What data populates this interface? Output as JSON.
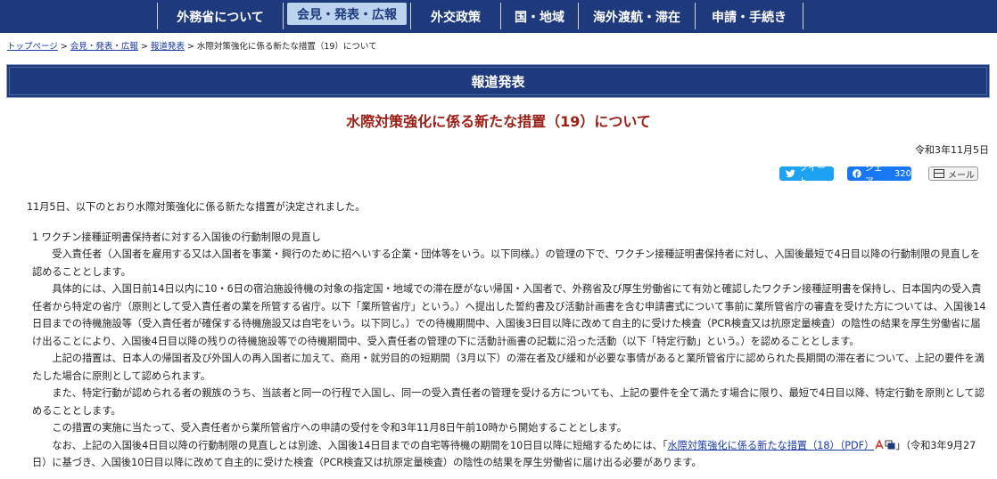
{
  "nav": {
    "items": [
      "外務省について",
      "会見・発表・広報",
      "外交政策",
      "国・地域",
      "海外渡航・滞在",
      "申請・手続き"
    ],
    "active_index": 1
  },
  "breadcrumb": {
    "home": "トップページ",
    "level1": "会見・発表・広報",
    "level2": "報道発表",
    "current": "水際対策強化に係る新たな措置（19）について",
    "sep": " > "
  },
  "banner": {
    "label": "報道発表"
  },
  "article": {
    "title": "水際対策強化に係る新たな措置（19）について",
    "date": "令和3年11月5日",
    "share": {
      "tweet": "ツイート",
      "facebook": "シェア",
      "facebook_count": "320",
      "mail": "メール"
    },
    "lead": "11月5日、以下のとおり水際対策強化に係る新たな措置が決定されました。",
    "section_heading": "1 ワクチン接種証明書保持者に対する入国後の行動制限の見直し",
    "paragraphs": [
      "受入責任者（入国者を雇用する又は入国者を事業・興行のために招へいする企業・団体等をいう。以下同様。）の管理の下で、ワクチン接種証明書保持者に対し、入国後最短で4日目以降の行動制限の見直しを認めることとします。",
      "具体的には、入国日前14日以内に10・6日の宿泊施設待機の対象の指定国・地域での滞在歴がない帰国・入国者で、外務省及び厚生労働省にて有効と確認したワクチン接種証明書を保持し、日本国内の受入責任者から特定の省庁（原則として受入責任者の業を所管する省庁。以下「業所管省庁」という。）へ提出した誓約書及び活動計画書を含む申請書式について事前に業所管省庁の審査を受けた方については、入国後14日目までの待機施設等（受入責任者が確保する待機施設又は自宅をいう。以下同じ。）での待機期間中、入国後3日目以降に改めて自主的に受けた検査（PCR検査又は抗原定量検査）の陰性の結果を厚生労働省に届け出ることにより、入国後4日目以降の残りの待機施設等での待機期間中、受入責任者の管理の下に活動計画書の記載に沿った活動（以下「特定行動」という。）を認めることとします。",
      "上記の措置は、日本人の帰国者及び外国人の再入国者に加えて、商用・就労目的の短期間（3月以下）の滞在者及び緩和が必要な事情があると業所管省庁に認められた長期間の滞在者について、上記の要件を満たした場合に原則として認められます。",
      "また、特定行動が認められる者の親族のうち、当該者と同一の行程で入国し、同一の受入責任者の管理を受ける方についても、上記の要件を全て満たす場合に限り、最短で4日目以降、特定行動を原則として認めることとします。",
      "この措置の実施に当たって、受入責任者から業所管省庁への申請の受付を令和3年11月8日午前10時から開始することとします。"
    ],
    "last_paragraph": {
      "before": "なお、上記の入国後4日目以降の行動制限の見直しとは別途、入国後14日目までの自宅等待機の期間を10日目以降に短縮するためには、「",
      "link": "水際対策強化に係る新たな措置（18）（PDF）",
      "after": "」（令和3年9月27日）に基づき、入国後10日目以降に改めて自主的に受けた検査（PCR検査又は抗原定量検査）の陰性の結果を厚生労働省に届け出る必要があります。"
    }
  },
  "colors": {
    "nav_bg": "#1f3a7c",
    "title": "#9b1d14",
    "link": "#1a3aa8",
    "twitter": "#1da1f2",
    "facebook": "#1877f2"
  },
  "icons": [
    "twitter-bird-icon",
    "facebook-icon",
    "mail-icon",
    "pdf-icon",
    "new-window-icon"
  ]
}
